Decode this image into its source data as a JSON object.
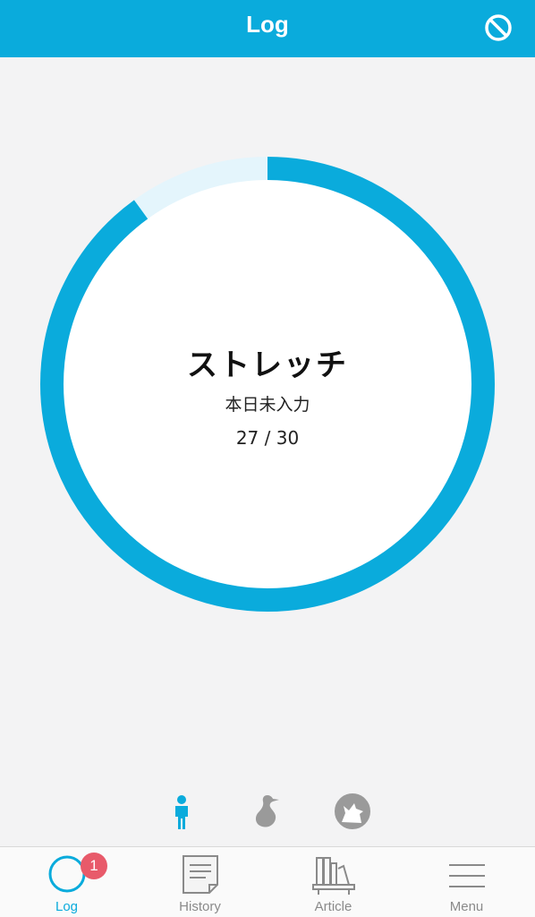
{
  "header": {
    "title": "Log",
    "action_icon": "block-icon"
  },
  "activity": {
    "name": "ストレッチ",
    "status": "本日未入力",
    "progress_text": "27 / 30",
    "progress_value": 27,
    "progress_max": 30
  },
  "colors": {
    "accent": "#0aabdc",
    "track": "#e4f5fc",
    "inactive_icon": "#9a9a9a",
    "badge": "#e85a6a"
  },
  "activity_switcher": {
    "items": [
      {
        "icon": "person-icon",
        "active": true
      },
      {
        "icon": "bird-icon",
        "active": false
      },
      {
        "icon": "wolf-icon",
        "active": false
      }
    ]
  },
  "tabbar": {
    "tabs": [
      {
        "label": "Log",
        "icon": "circle-icon",
        "active": true,
        "badge": "1"
      },
      {
        "label": "History",
        "icon": "document-icon",
        "active": false
      },
      {
        "label": "Article",
        "icon": "bookshelf-icon",
        "active": false
      },
      {
        "label": "Menu",
        "icon": "menu-icon",
        "active": false
      }
    ]
  }
}
